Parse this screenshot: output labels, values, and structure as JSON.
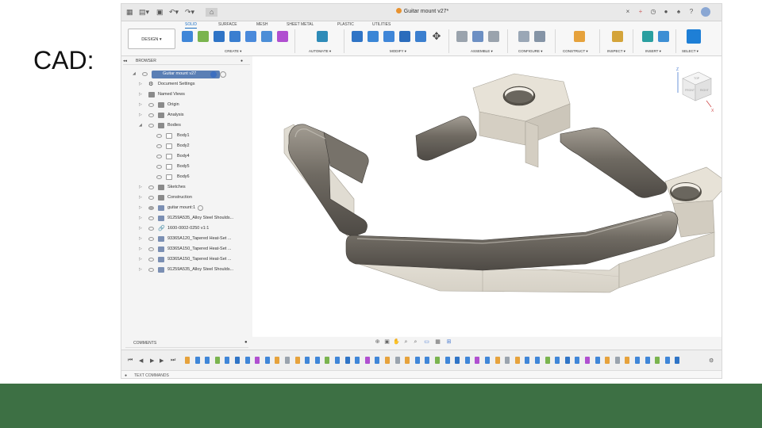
{
  "slide": {
    "label": "CAD:"
  },
  "window": {
    "title": "Guitar mount v27*"
  },
  "ribbon": {
    "workspace": "DESIGN ▾",
    "tabs": [
      "SOLID",
      "SURFACE",
      "MESH",
      "SHEET METAL",
      "PLASTIC",
      "UTILITIES"
    ],
    "active_tab": "SOLID",
    "groups": [
      "CREATE ▾",
      "AUTOMATE ▾",
      "MODIFY ▾",
      "ASSEMBLE ▾",
      "CONFIGURE ▾",
      "CONSTRUCT ▾",
      "INSPECT ▾",
      "INSERT ▾",
      "SELECT ▾"
    ]
  },
  "browser": {
    "title": "BROWSER",
    "root": "Guitar mount v27",
    "items": [
      "Document Settings",
      "Named Views",
      "Origin",
      "Analysis",
      "Bodies",
      "Body1",
      "Body2",
      "Body4",
      "Body5",
      "Body6",
      "Sketches",
      "Construction",
      "guitar mount:1",
      "91259A535_Alloy Steel Shoulds...",
      "1600-0002-0250 v1:1",
      "93365A120_Tapered Heat-Set ...",
      "93365A150_Tapered Heat-Set ...",
      "93365A150_Tapered Heat-Set ...",
      "91259A535_Alloy Steel Shoulds..."
    ]
  },
  "viewcube": {
    "top": "TOP",
    "front": "FRONT",
    "right": "RIGHT",
    "axis_x": "X",
    "axis_z": "Z"
  },
  "comments": {
    "label": "COMMENTS"
  },
  "text_commands": {
    "label": "TEXT COMMANDS"
  },
  "colors": {
    "green_band": "#3d7044",
    "accent": "#1a6ec2",
    "part_light": "#e6e2d8",
    "part_dark": "#6f6a62"
  }
}
